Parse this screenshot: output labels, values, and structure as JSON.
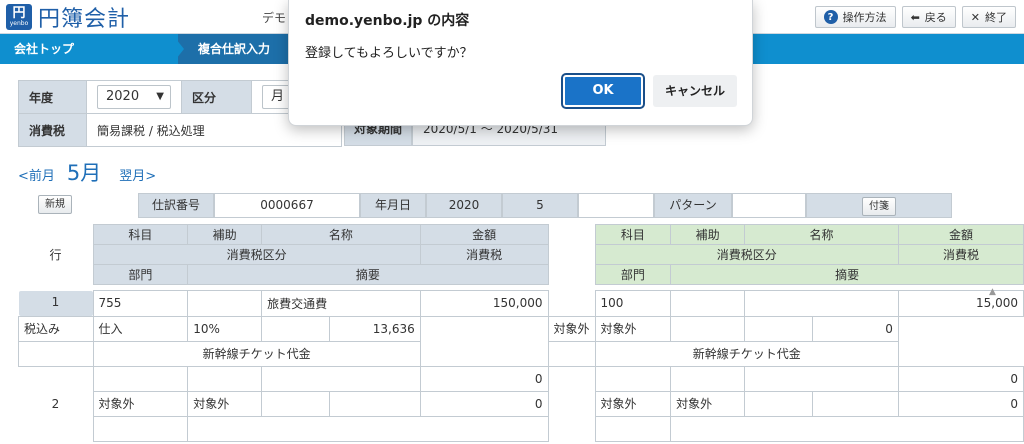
{
  "header": {
    "logo_mark": "円",
    "logo_sub": "yenbo",
    "app_title": "円簿会計",
    "demo_text": "デモ",
    "buttons": [
      {
        "label": "操作方法",
        "icon": "?"
      },
      {
        "label": "戻る",
        "icon": "◆"
      },
      {
        "label": "終了",
        "icon": "✕"
      }
    ]
  },
  "nav": {
    "top": "会社トップ",
    "current": "複合仕訳入力"
  },
  "filters": {
    "year_label": "年度",
    "year_value": "2020",
    "kubun_label": "区分",
    "kubun_value": "月",
    "tax_label": "消費税",
    "tax_value": "簡易課税 / 税込処理",
    "period_label": "対象期間",
    "period_value": "2020/5/1 ～ 2020/5/31"
  },
  "month_nav": {
    "prev": "<前月",
    "current": "5月",
    "next": "翌月>"
  },
  "entry": {
    "new_btn": "新規",
    "number_label": "仕訳番号",
    "number_value": "0000667",
    "date_label": "年月日",
    "year": "2020",
    "month": "5",
    "day": "",
    "pattern_label": "パターン",
    "pattern_value": "",
    "sticky_btn": "付箋"
  },
  "table": {
    "row_label": "行",
    "left_h1": [
      "科目",
      "補助",
      "名称",
      "金額"
    ],
    "left_h2": [
      "消費税区分",
      "消費税"
    ],
    "left_h3": [
      "部門",
      "摘要"
    ],
    "right_h1": [
      "科目",
      "補助",
      "名称",
      "金額"
    ],
    "right_h2": [
      "消費税区分",
      "消費税"
    ],
    "right_h3": [
      "部門",
      "摘要"
    ],
    "rows": [
      {
        "no": "1",
        "l_code": "755",
        "l_sub": "",
        "l_name": "旅費交通費",
        "l_amount": "150,000",
        "l_tax1": "税込み",
        "l_tax2": "仕入",
        "l_tax3": "10%",
        "l_tax_amt": "13,636",
        "l_dept": "",
        "l_memo": "新幹線チケット代金",
        "r_code": "100",
        "r_sub": "",
        "r_name": "",
        "r_amount": "15,000",
        "r_tax1": "対象外",
        "r_tax2": "対象外",
        "r_tax3": "",
        "r_tax_amt": "0",
        "r_dept": "",
        "r_memo": "新幹線チケット代金"
      },
      {
        "no": "2",
        "l_code": "",
        "l_sub": "",
        "l_name": "",
        "l_amount": "0",
        "l_tax1": "対象外",
        "l_tax2": "対象外",
        "l_tax3": "",
        "l_tax_amt": "0",
        "l_dept": "",
        "l_memo": "",
        "r_code": "",
        "r_sub": "",
        "r_name": "",
        "r_amount": "0",
        "r_tax1": "対象外",
        "r_tax2": "対象外",
        "r_tax3": "",
        "r_tax_amt": "0",
        "r_dept": "",
        "r_memo": ""
      }
    ]
  },
  "dialog": {
    "title": "demo.yenbo.jp の内容",
    "message": "登録してもよろしいですか？",
    "ok": "OK",
    "cancel": "キャンセル"
  }
}
